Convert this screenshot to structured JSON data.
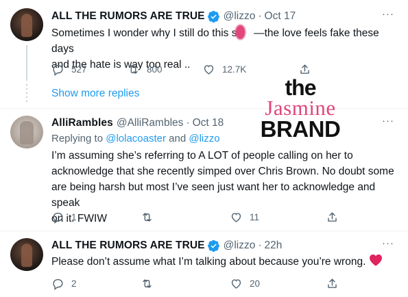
{
  "tweets": [
    {
      "name": "ALL THE RUMORS ARE TRUE",
      "handle": "@lizzo",
      "separator": "·",
      "time": "Oct 17",
      "text_line1": "Sometimes I wonder why I still do this sh",
      "text_line1_end": "—the love feels fake these days",
      "text_line2": "and the hate is way too real ..",
      "replies": "527",
      "retweets": "800",
      "likes": "12.7K",
      "more": "···"
    },
    {
      "name": "AlliRambles",
      "handle": "@AlliRambles",
      "separator": "·",
      "time": "Oct 18",
      "replying_prefix": "Replying to",
      "replying_user1": "@lolacoaster",
      "replying_and": "and",
      "replying_user2": "@lizzo",
      "text_line1": "I’m assuming she’s referring to A LOT of people calling on her to",
      "text_line2": "acknowledge that she recently simped over Chris Brown. No doubt some",
      "text_line3": "are being harsh but most I’ve seen just want her to acknowledge and speak",
      "text_line4": "on it. FWIW",
      "replies": "1",
      "retweets": "",
      "likes": "11",
      "more": "···"
    },
    {
      "name": "ALL THE RUMORS ARE TRUE",
      "handle": "@lizzo",
      "separator": "·",
      "time": "22h",
      "text": "Please don’t assume what I’m talking about because you’re wrong.",
      "replies": "2",
      "retweets": "",
      "likes": "20",
      "more": "···"
    }
  ],
  "show_more_replies": "Show more replies",
  "watermark": {
    "the": "the",
    "jasmine": "Jasmine",
    "brand": "BRAND"
  },
  "colors": {
    "accent": "#1d9bf0",
    "text": "#0f1419",
    "muted": "#536471",
    "brand_pink": "#e0457b",
    "heart": "#e0245e"
  },
  "icons": [
    "verified-badge-icon",
    "reply-icon",
    "retweet-icon",
    "like-icon",
    "share-icon",
    "more-icon",
    "red-heart-icon"
  ]
}
